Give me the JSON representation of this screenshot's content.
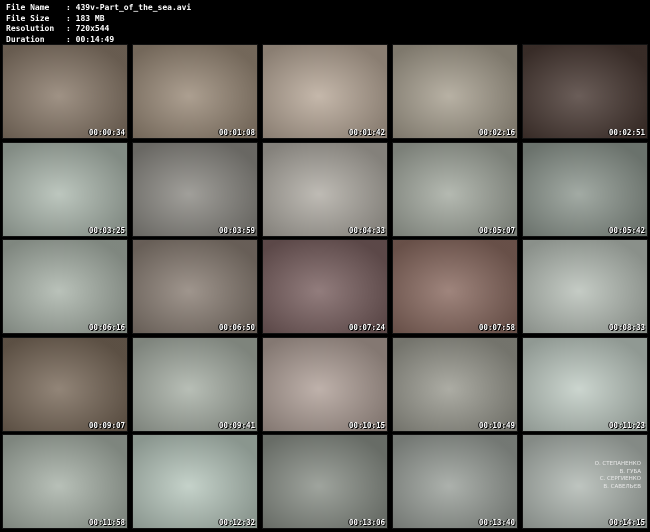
{
  "header": {
    "rows": [
      {
        "label": "File Name",
        "value": ": 439v-Part_of_the_sea.avi"
      },
      {
        "label": "File Size",
        "value": ": 183 MB"
      },
      {
        "label": "Resolution",
        "value": ": 720x544"
      },
      {
        "label": "Duration",
        "value": ": 00:14:49"
      }
    ]
  },
  "thumbnails": [
    {
      "time": "00:00:34",
      "bg": "#8a7a6a"
    },
    {
      "time": "00:01:08",
      "bg": "#9a8a78"
    },
    {
      "time": "00:01:42",
      "bg": "#b8a898"
    },
    {
      "time": "00:02:16",
      "bg": "#a8a090"
    },
    {
      "time": "00:02:51",
      "bg": "#4a3a34"
    },
    {
      "time": "00:03:25",
      "bg": "#aebab0"
    },
    {
      "time": "00:03:59",
      "bg": "#8c8a84"
    },
    {
      "time": "00:04:33",
      "bg": "#b0aca4"
    },
    {
      "time": "00:05:07",
      "bg": "#a4aaa0"
    },
    {
      "time": "00:05:42",
      "bg": "#8e9890"
    },
    {
      "time": "00:06:16",
      "bg": "#aab4aa"
    },
    {
      "time": "00:06:50",
      "bg": "#8a7e74"
    },
    {
      "time": "00:07:24",
      "bg": "#7a6060"
    },
    {
      "time": "00:07:58",
      "bg": "#8a6a60"
    },
    {
      "time": "00:08:33",
      "bg": "#b8c0b8"
    },
    {
      "time": "00:09:07",
      "bg": "#7a6a5a"
    },
    {
      "time": "00:09:41",
      "bg": "#a8b0a6"
    },
    {
      "time": "00:10:15",
      "bg": "#b0a098"
    },
    {
      "time": "00:10:49",
      "bg": "#9a9a90"
    },
    {
      "time": "00:11:23",
      "bg": "#c0ccc4"
    },
    {
      "time": "00:11:58",
      "bg": "#a8b2a8"
    },
    {
      "time": "00:12:32",
      "bg": "#b8c8be"
    },
    {
      "time": "00:13:06",
      "bg": "#8a9088"
    },
    {
      "time": "00:13:40",
      "bg": "#9aa09a"
    },
    {
      "time": "00:14:15",
      "bg": "#b0b8b2"
    }
  ],
  "credits": [
    "О. СТЕПАНЕНКО",
    "В. ГУБА",
    "С. СЕРГИЕНКО",
    "В. САВЕЛЬЄВ"
  ]
}
